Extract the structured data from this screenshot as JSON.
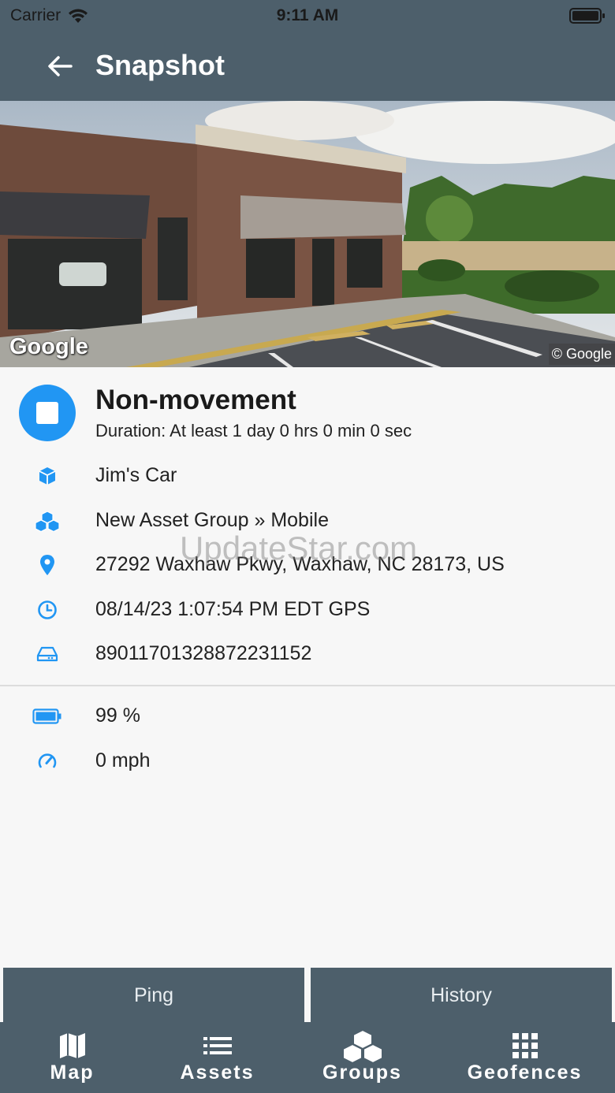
{
  "status_bar": {
    "carrier": "Carrier",
    "time": "9:11 AM"
  },
  "header": {
    "title": "Snapshot"
  },
  "photo": {
    "logo_text": "Google",
    "copyright": "© Google"
  },
  "event": {
    "title": "Non-movement",
    "duration": "Duration: At least 1 day 0 hrs 0 min 0 sec"
  },
  "details": [
    {
      "icon": "cube-icon",
      "text": "Jim's Car"
    },
    {
      "icon": "cubes-icon",
      "text": "New Asset Group » Mobile"
    },
    {
      "icon": "location-pin-icon",
      "text": "27292 Waxhaw Pkwy, Waxhaw, NC 28173, US"
    },
    {
      "icon": "clock-icon",
      "text": "08/14/23 1:07:54 PM EDT GPS"
    },
    {
      "icon": "device-icon",
      "text": "89011701328872231152"
    }
  ],
  "metrics": [
    {
      "icon": "battery-icon",
      "text": "99 %"
    },
    {
      "icon": "speedometer-icon",
      "text": "0 mph"
    }
  ],
  "watermark": "UpdateStar.com",
  "actions": {
    "ping": "Ping",
    "history": "History"
  },
  "tabs": [
    {
      "icon": "map-icon",
      "label": "Map"
    },
    {
      "icon": "list-icon",
      "label": "Assets"
    },
    {
      "icon": "cubes-icon",
      "label": "Groups"
    },
    {
      "icon": "grid-icon",
      "label": "Geofences"
    }
  ],
  "colors": {
    "header": "#4d5f6b",
    "accent": "#2196f3",
    "background": "#f7f7f7"
  }
}
